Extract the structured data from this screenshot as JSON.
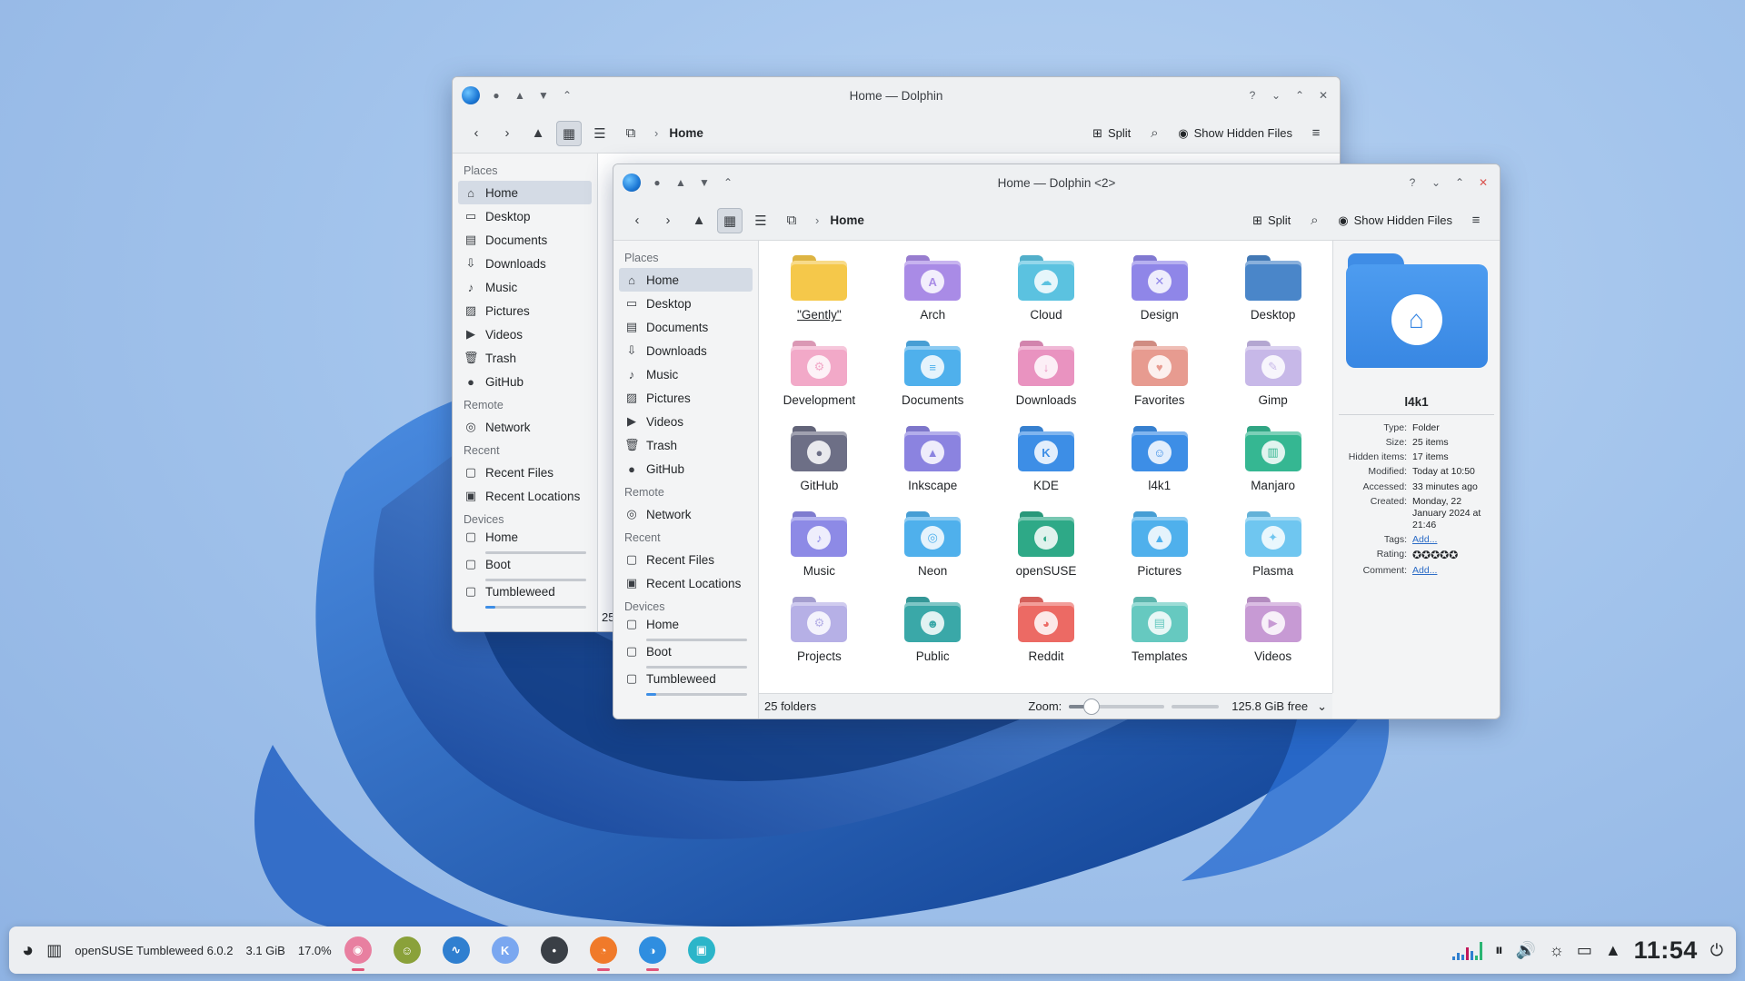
{
  "colors": {
    "accent": "#3d8ee6",
    "selection": "#d4dbe5",
    "link": "#2c6cc6"
  },
  "back_window": {
    "title": "Home — Dolphin",
    "breadcrumb": "Home",
    "split_label": "Split",
    "hidden_files_label": "Show Hidden Files",
    "status_partial": "25",
    "places_header": "Places",
    "places": [
      {
        "label": "Home",
        "icon": "home-icon"
      },
      {
        "label": "Desktop",
        "icon": "desktop-icon"
      },
      {
        "label": "Documents",
        "icon": "documents-icon"
      },
      {
        "label": "Downloads",
        "icon": "downloads-icon"
      },
      {
        "label": "Music",
        "icon": "music-icon"
      },
      {
        "label": "Pictures",
        "icon": "pictures-icon"
      },
      {
        "label": "Videos",
        "icon": "videos-icon"
      },
      {
        "label": "Trash",
        "icon": "trash-icon"
      },
      {
        "label": "GitHub",
        "icon": "github-icon"
      }
    ],
    "remote_header": "Remote",
    "remote": [
      {
        "label": "Network",
        "icon": "network-icon"
      }
    ],
    "recent_header": "Recent",
    "recent": [
      {
        "label": "Recent Files",
        "icon": "recent-files-icon"
      },
      {
        "label": "Recent Locations",
        "icon": "recent-locations-icon"
      }
    ],
    "devices_header": "Devices",
    "devices": [
      {
        "label": "Home",
        "usage": 0.0
      },
      {
        "label": "Boot",
        "usage": 0.0
      },
      {
        "label": "Tumbleweed",
        "usage": 0.1
      }
    ]
  },
  "front_window": {
    "title": "Home — Dolphin <2>",
    "breadcrumb": "Home",
    "split_label": "Split",
    "hidden_files_label": "Show Hidden Files",
    "places_header": "Places",
    "places": [
      {
        "label": "Home",
        "icon": "home-icon"
      },
      {
        "label": "Desktop",
        "icon": "desktop-icon"
      },
      {
        "label": "Documents",
        "icon": "documents-icon"
      },
      {
        "label": "Downloads",
        "icon": "downloads-icon"
      },
      {
        "label": "Music",
        "icon": "music-icon"
      },
      {
        "label": "Pictures",
        "icon": "pictures-icon"
      },
      {
        "label": "Videos",
        "icon": "videos-icon"
      },
      {
        "label": "Trash",
        "icon": "trash-icon"
      },
      {
        "label": "GitHub",
        "icon": "github-icon"
      }
    ],
    "remote_header": "Remote",
    "remote": [
      {
        "label": "Network",
        "icon": "network-icon"
      }
    ],
    "recent_header": "Recent",
    "recent": [
      {
        "label": "Recent Files",
        "icon": "recent-files-icon"
      },
      {
        "label": "Recent Locations",
        "icon": "recent-locations-icon"
      }
    ],
    "devices_header": "Devices",
    "devices": [
      {
        "label": "Home",
        "usage": 0.0
      },
      {
        "label": "Boot",
        "usage": 0.0
      },
      {
        "label": "Tumbleweed",
        "usage": 0.1
      }
    ],
    "folders": [
      {
        "label": "\"Gently\"",
        "color": "#f5c84a",
        "emblem": "",
        "icon": "gently-folder-icon"
      },
      {
        "label": "Arch",
        "color": "#a98be6",
        "emblem": "A",
        "icon": "arch-folder-icon"
      },
      {
        "label": "Cloud",
        "color": "#5bc2e0",
        "emblem": "☁",
        "icon": "cloud-folder-icon"
      },
      {
        "label": "Design",
        "color": "#8f86e8",
        "emblem": "✕",
        "icon": "design-folder-icon"
      },
      {
        "label": "Desktop",
        "color": "#4a86c9",
        "emblem": "",
        "icon": "desktop-folder-icon"
      },
      {
        "label": "Development",
        "color": "#f2a9c8",
        "emblem": "⚙",
        "icon": "development-folder-icon"
      },
      {
        "label": "Documents",
        "color": "#4fb0ec",
        "emblem": "≡",
        "icon": "documents-folder-icon"
      },
      {
        "label": "Downloads",
        "color": "#e993c0",
        "emblem": "↓",
        "icon": "downloads-folder-icon"
      },
      {
        "label": "Favorites",
        "color": "#e79b90",
        "emblem": "♥",
        "icon": "favorites-folder-icon"
      },
      {
        "label": "Gimp",
        "color": "#c7b8e8",
        "emblem": "✎",
        "icon": "gimp-folder-icon"
      },
      {
        "label": "GitHub",
        "color": "#6d6f86",
        "emblem": "●",
        "icon": "github-folder-icon"
      },
      {
        "label": "Inkscape",
        "color": "#8b83e0",
        "emblem": "▲",
        "icon": "inkscape-folder-icon"
      },
      {
        "label": "KDE",
        "color": "#3d8ee6",
        "emblem": "K",
        "icon": "kde-folder-icon"
      },
      {
        "label": "l4k1",
        "color": "#3d8ee6",
        "emblem": "☺",
        "icon": "l4k1-folder-icon"
      },
      {
        "label": "Manjaro",
        "color": "#35b792",
        "emblem": "▥",
        "icon": "manjaro-folder-icon"
      },
      {
        "label": "Music",
        "color": "#8d8ae6",
        "emblem": "♪",
        "icon": "music-folder-icon"
      },
      {
        "label": "Neon",
        "color": "#4fb0ec",
        "emblem": "◎",
        "icon": "neon-folder-icon"
      },
      {
        "label": "openSUSE",
        "color": "#2ea987",
        "emblem": "◐",
        "icon": "opensuse-folder-icon"
      },
      {
        "label": "Pictures",
        "color": "#4fb0ec",
        "emblem": "▲",
        "icon": "pictures-folder-icon"
      },
      {
        "label": "Plasma",
        "color": "#6fc6f0",
        "emblem": "✦",
        "icon": "plasma-folder-icon"
      },
      {
        "label": "Projects",
        "color": "#b6b0e6",
        "emblem": "⚙",
        "icon": "projects-folder-icon"
      },
      {
        "label": "Public",
        "color": "#3aa8a8",
        "emblem": "☻",
        "icon": "public-folder-icon"
      },
      {
        "label": "Reddit",
        "color": "#ec6a64",
        "emblem": "◕",
        "icon": "reddit-folder-icon"
      },
      {
        "label": "Templates",
        "color": "#66c9c0",
        "emblem": "▤",
        "icon": "templates-folder-icon"
      },
      {
        "label": "Videos",
        "color": "#c79ad4",
        "emblem": "▶",
        "icon": "videos-folder-icon"
      }
    ],
    "status": {
      "count": "25 folders",
      "zoom_label": "Zoom:",
      "zoom_level": 0.24,
      "free_space": "125.8 GiB free"
    },
    "info_panel": {
      "name": "l4k1",
      "rows": [
        {
          "key": "Type:",
          "value": "Folder"
        },
        {
          "key": "Size:",
          "value": "25 items"
        },
        {
          "key": "Hidden items:",
          "value": "17 items"
        },
        {
          "key": "Modified:",
          "value": "Today at 10:50"
        },
        {
          "key": "Accessed:",
          "value": "33 minutes ago"
        },
        {
          "key": "Created:",
          "value": "Monday, 22 January 2024 at 21:46"
        }
      ],
      "tags_key": "Tags:",
      "tags_value": "Add...",
      "rating_key": "Rating:",
      "rating_value": 0,
      "comment_key": "Comment:",
      "comment_value": "Add..."
    }
  },
  "taskbar": {
    "system_label": "openSUSE Tumbleweed 6.0.2",
    "memory": "3.1 GiB",
    "cpu": "17.0%",
    "apps": [
      {
        "icon": "sticker-app-icon",
        "color": "#e87fa0",
        "glyph": "◉",
        "active": true
      },
      {
        "icon": "geeko-app-icon",
        "color": "#8aa13a",
        "glyph": "☺",
        "active": false
      },
      {
        "icon": "monitor-app-icon",
        "color": "#2f7fd0",
        "glyph": "∿",
        "active": false
      },
      {
        "icon": "kde-app-icon",
        "color": "#7aa7f0",
        "glyph": "K",
        "active": false
      },
      {
        "icon": "terminal-app-icon",
        "color": "#3a3f46",
        "glyph": "•",
        "active": false
      },
      {
        "icon": "firefox-app-icon",
        "color": "#f07a2a",
        "glyph": "◔",
        "active": true
      },
      {
        "icon": "dolphin-app-icon",
        "color": "#2f8ee0",
        "glyph": "◑",
        "active": true
      },
      {
        "icon": "discover-app-icon",
        "color": "#2bb5c9",
        "glyph": "▣",
        "active": false
      }
    ],
    "clock": "11:54"
  }
}
